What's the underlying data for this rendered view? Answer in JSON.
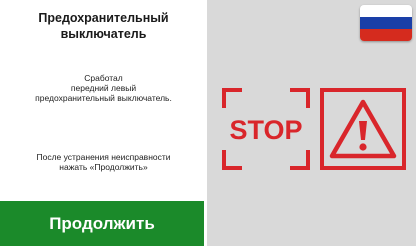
{
  "panel": {
    "title_lines": [
      "Предохранительный",
      "выключатель"
    ],
    "message_lines": [
      "Сработал",
      "передний левый",
      "предохранительный выключатель."
    ],
    "hint_lines": [
      "После устранения неисправности",
      "нажать «Продолжить»"
    ],
    "continue_label": "Продолжить"
  },
  "icons": {
    "flag": "russian-flag-icon",
    "stop": "stop-sign-icon",
    "warning": "warning-triangle-icon",
    "stop_text": "STOP"
  },
  "colors": {
    "accent_green": "#1b8a2a",
    "alert_red": "#d9262b",
    "right_panel_bg": "#d9d9d9",
    "flag_white": "#ffffff",
    "flag_blue": "#1a3fa8",
    "flag_red": "#d52b1e"
  }
}
